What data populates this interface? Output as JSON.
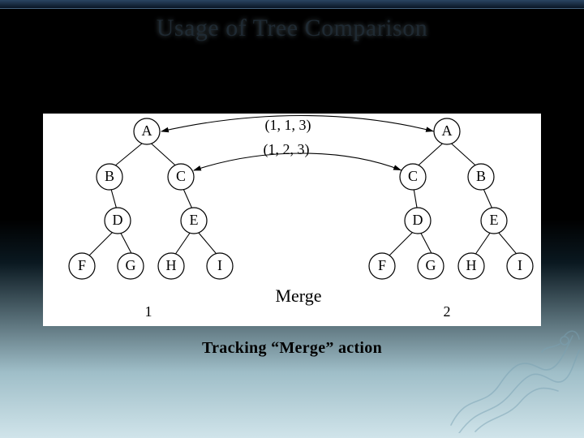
{
  "title": "Usage of Tree Comparison",
  "caption": "Tracking “Merge” action",
  "figure": {
    "diagram_label": "Merge",
    "tree_left_number": "1",
    "tree_right_number": "2",
    "annotation_top": "(1, 1, 3)",
    "annotation_bottom": "(1, 2, 3)",
    "tree_left": {
      "root": "A",
      "children": [
        {
          "label": "B",
          "children": [
            {
              "label": "D",
              "children": [
                {
                  "label": "F"
                },
                {
                  "label": "G"
                }
              ]
            }
          ]
        },
        {
          "label": "C",
          "children": [
            {
              "label": "E",
              "children": [
                {
                  "label": "H"
                },
                {
                  "label": "I"
                }
              ]
            }
          ]
        }
      ]
    },
    "tree_right": {
      "root": "A",
      "children": [
        {
          "label": "C",
          "children": [
            {
              "label": "D",
              "children": [
                {
                  "label": "F"
                },
                {
                  "label": "G"
                }
              ]
            }
          ]
        },
        {
          "label": "B",
          "children": [
            {
              "label": "E",
              "children": [
                {
                  "label": "H"
                },
                {
                  "label": "I"
                }
              ]
            }
          ]
        }
      ]
    }
  }
}
